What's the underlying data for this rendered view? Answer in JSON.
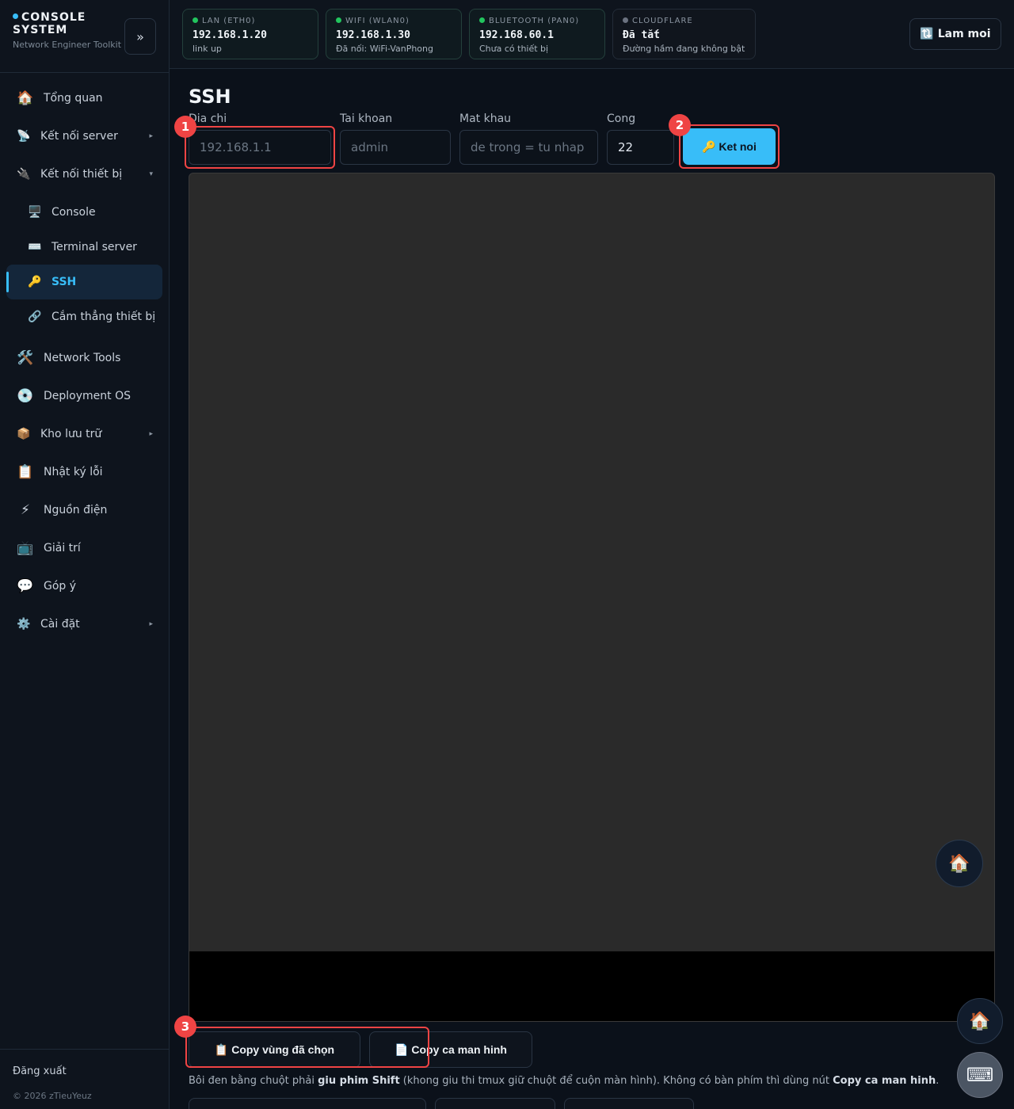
{
  "brand": {
    "title": "CONSOLE SYSTEM",
    "subtitle": "Network Engineer Toolkit",
    "collapse_label": "»"
  },
  "sidebar": {
    "items": [
      {
        "icon": "🏠",
        "label": "Tổng quan"
      },
      {
        "icon": "📡",
        "label": "Kết nối server"
      },
      {
        "icon": "🔌",
        "label": "Kết nối thiết bị"
      },
      {
        "icon": "🖥️",
        "label": "Console"
      },
      {
        "icon": "⌨️",
        "label": "Terminal server"
      },
      {
        "icon": "🔑",
        "label": "SSH"
      },
      {
        "icon": "🔗",
        "label": "Cắm thẳng thiết bị"
      },
      {
        "icon": "🛠️",
        "label": "Network Tools"
      },
      {
        "icon": "💿",
        "label": "Deployment OS"
      },
      {
        "icon": "📦",
        "label": "Kho lưu trữ"
      },
      {
        "icon": "📋",
        "label": "Nhật ký lỗi"
      },
      {
        "icon": "⚡",
        "label": "Nguồn điện"
      },
      {
        "icon": "📺",
        "label": "Giải trí"
      },
      {
        "icon": "💬",
        "label": "Góp ý"
      },
      {
        "icon": "⚙️",
        "label": "Cài đặt"
      }
    ],
    "arrow_right": "▸",
    "arrow_down": "▾",
    "logout": "Đăng xuất",
    "copyright": "© 2026 zTieuYeuz"
  },
  "status_cards": [
    {
      "label": "LAN (ETH0)",
      "value": "192.168.1.20",
      "sub": "link up"
    },
    {
      "label": "WIFI (WLAN0)",
      "value": "192.168.1.30",
      "sub": "Đã nối: WiFi-VanPhong"
    },
    {
      "label": "BLUETOOTH (PAN0)",
      "value": "192.168.60.1",
      "sub": "Chưa có thiết bị"
    },
    {
      "label": "CLOUDFLARE",
      "value": "Đã tắt",
      "sub": "Đường hầm đang không bật"
    }
  ],
  "header": {
    "refresh_label": "🔃 Lam moi"
  },
  "ssh": {
    "title": "SSH",
    "address_label": "Dia chi",
    "address_placeholder": "192.168.1.1",
    "account_label": "Tai khoan",
    "account_placeholder": "admin",
    "password_label": "Mat khau",
    "password_placeholder": "de trong = tu nhap",
    "port_label": "Cong",
    "port_value": "22",
    "connect_label": "🔑 Ket noi"
  },
  "badges": [
    "1",
    "2",
    "3"
  ],
  "fab": {
    "home_icon": "🏠",
    "keyboard_icon": "⌨"
  },
  "copy": {
    "selection_label": "📋 Copy vùng đã chọn",
    "screen_label": "📄 Copy ca man hinh"
  },
  "help": {
    "part1": "Bôi đen bằng chuột phải ",
    "bold1": "giu phim Shift",
    "part2": " (khong giu thi tmux giữ chuột để cuộn màn hình). Không có bàn phím thì dùng nút ",
    "bold2": "Copy ca man hinh",
    "part3": "."
  }
}
